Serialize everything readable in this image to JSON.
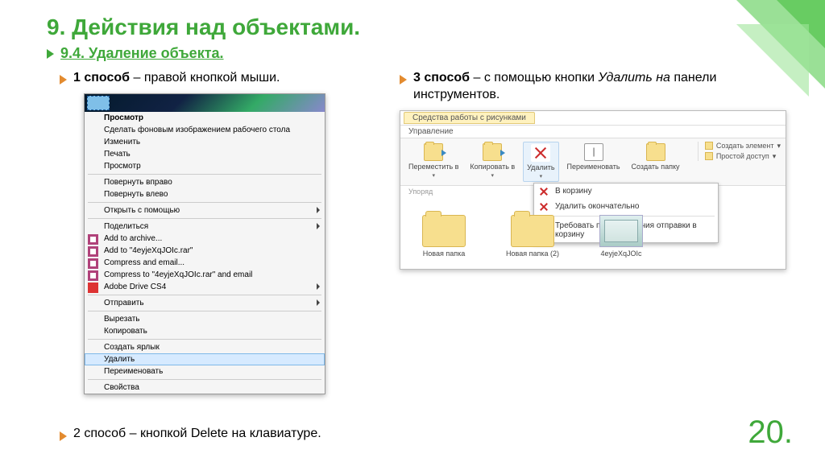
{
  "slide": {
    "title": "9. Действия над объектами.",
    "subtitle": "9.4. Удаление объекта.",
    "number": "20."
  },
  "methods": {
    "m1": {
      "label": "1 способ",
      "sep": " – ",
      "desc": "правой кнопкой мыши."
    },
    "m2": {
      "label": "2 способ",
      "sep": " – ",
      "desc_pre": "кнопкой ",
      "ital": "Delete",
      "desc_post": " на клавиатуре."
    },
    "m3": {
      "label": "3 способ",
      "sep": " – ",
      "desc_pre": "с помощью кнопки ",
      "ital": "Удалить на",
      "desc_post": " панели инструментов."
    }
  },
  "context_menu": [
    {
      "t": "Просмотр",
      "bold": true
    },
    {
      "t": "Сделать фоновым изображением рабочего стола"
    },
    {
      "t": "Изменить"
    },
    {
      "t": "Печать"
    },
    {
      "t": "Просмотр"
    },
    {
      "sep": true
    },
    {
      "t": "Повернуть вправо"
    },
    {
      "t": "Повернуть влево"
    },
    {
      "sep": true
    },
    {
      "t": "Открыть с помощью",
      "sub": true
    },
    {
      "sep": true
    },
    {
      "t": "Поделиться",
      "sub": true
    },
    {
      "t": "Add to archive...",
      "ic": "rar"
    },
    {
      "t": "Add to \"4eyjeXqJOIc.rar\"",
      "ic": "rar"
    },
    {
      "t": "Compress and email...",
      "ic": "rar"
    },
    {
      "t": "Compress to \"4eyjeXqJOIc.rar\" and email",
      "ic": "rar"
    },
    {
      "t": "Adobe Drive CS4",
      "ic": "adobe",
      "sub": true
    },
    {
      "sep": true
    },
    {
      "t": "Отправить",
      "sub": true
    },
    {
      "sep": true
    },
    {
      "t": "Вырезать"
    },
    {
      "t": "Копировать"
    },
    {
      "sep": true
    },
    {
      "t": "Создать ярлык"
    },
    {
      "t": "Удалить",
      "selected": true
    },
    {
      "t": "Переименовать"
    },
    {
      "sep": true
    },
    {
      "t": "Свойства"
    }
  ],
  "explorer": {
    "tab_context": "Средства работы с рисунками",
    "tab_sub": "Управление",
    "ribbon": {
      "move": "Переместить в",
      "copy": "Копировать в",
      "delete": "Удалить",
      "rename": "Переименовать",
      "newfolder": "Создать папку",
      "newitem": "Создать элемент",
      "easy": "Простой доступ",
      "sort_label": "Упоряд"
    },
    "delete_dropdown": {
      "recycle": "В корзину",
      "perm": "Удалить окончательно",
      "confirm": "Требовать подтверждения отправки в корзину"
    },
    "files": {
      "f1": "Новая папка",
      "f2": "Новая папка (2)",
      "f3": "4eyjeXqJOIc"
    }
  }
}
